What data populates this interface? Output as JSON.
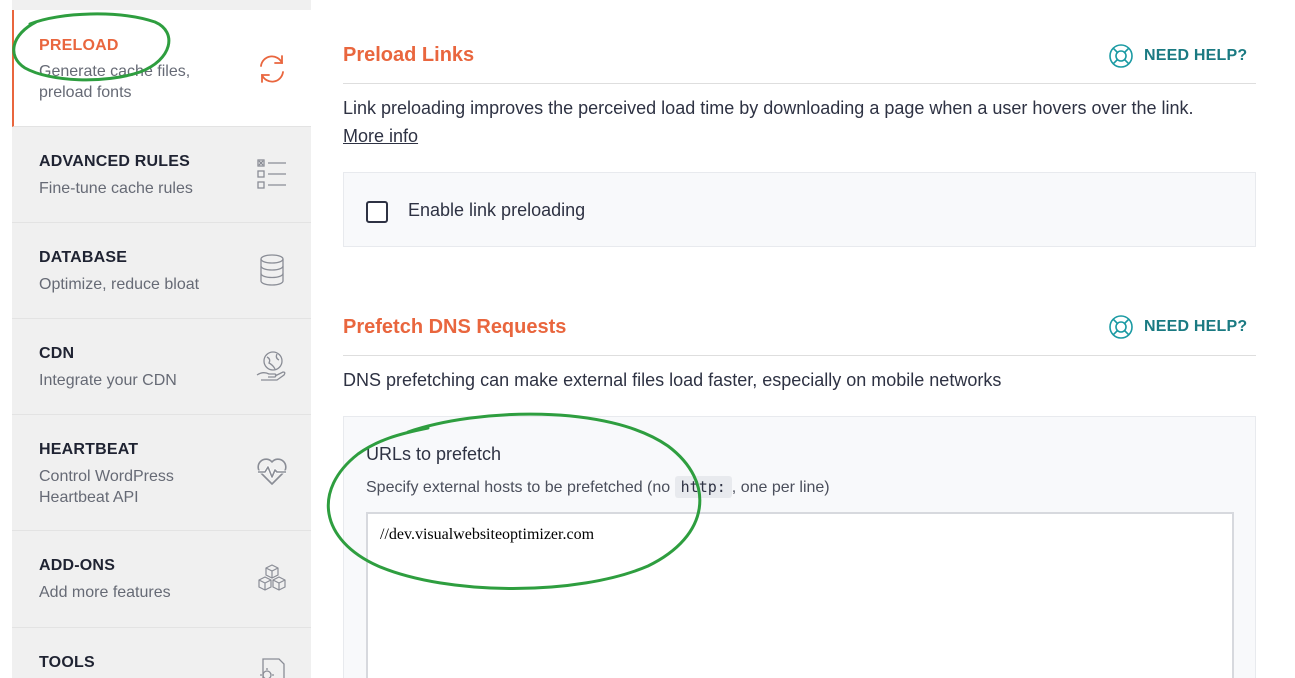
{
  "sidebar": {
    "items": [
      {
        "title": "PRELOAD",
        "subtitle": "Generate cache files, preload fonts",
        "icon": "refresh-icon",
        "active": true
      },
      {
        "title": "ADVANCED RULES",
        "subtitle": "Fine-tune cache rules",
        "icon": "checklist-icon",
        "active": false
      },
      {
        "title": "DATABASE",
        "subtitle": "Optimize, reduce bloat",
        "icon": "database-icon",
        "active": false
      },
      {
        "title": "CDN",
        "subtitle": "Integrate your CDN",
        "icon": "globe-hand-icon",
        "active": false
      },
      {
        "title": "HEARTBEAT",
        "subtitle": "Control WordPress Heartbeat API",
        "icon": "heartbeat-icon",
        "active": false
      },
      {
        "title": "ADD-ONS",
        "subtitle": "Add more features",
        "icon": "cubes-icon",
        "active": false
      },
      {
        "title": "TOOLS",
        "subtitle": "",
        "icon": "tools-gear-icon",
        "active": false
      }
    ]
  },
  "preload_links": {
    "title": "Preload Links",
    "help_label": "NEED HELP?",
    "description": "Link preloading improves the perceived load time by downloading a page when a user hovers over the link.",
    "more_info": "More info",
    "checkbox_label": "Enable link preloading",
    "checkbox_checked": false
  },
  "prefetch_dns": {
    "title": "Prefetch DNS Requests",
    "help_label": "NEED HELP?",
    "description": "DNS prefetching can make external files load faster, especially on mobile networks",
    "field_label": "URLs to prefetch",
    "hint_before": "Specify external hosts to be prefetched (no",
    "hint_code": "http:",
    "hint_after": ", one per line)",
    "textarea_value": "//dev.visualwebsiteoptimizer.com"
  },
  "colors": {
    "accent": "#e9663e",
    "help": "#1a7a82",
    "annotation": "#2e9e3f",
    "sidebar_bg": "#f0f0f0"
  }
}
